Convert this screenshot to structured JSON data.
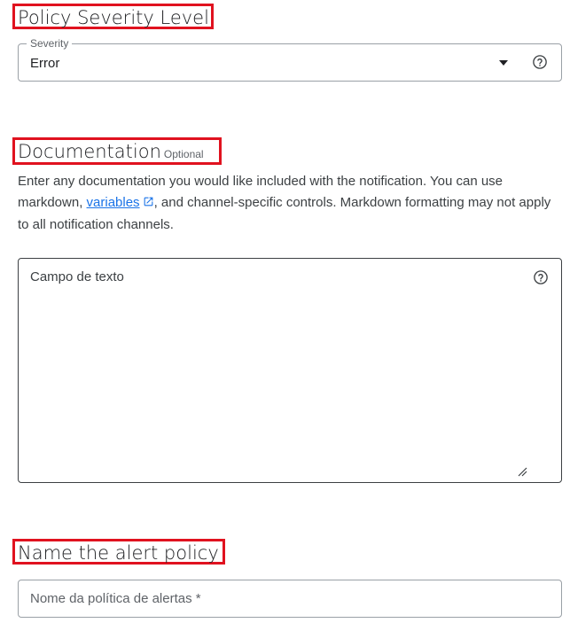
{
  "severity_section": {
    "title": "Policy Severity Level",
    "select": {
      "label": "Severity",
      "value": "Error"
    }
  },
  "documentation_section": {
    "title": "Documentation",
    "optional_tag": "Optional",
    "description_before_link": "Enter any documentation you would like included with the notification. You can use markdown, ",
    "link_text": "variables",
    "description_after_link": ", and channel-specific controls. Markdown formatting may not apply to all notification channels.",
    "textarea": {
      "placeholder": "Campo de texto"
    }
  },
  "name_section": {
    "title": "Name the alert policy",
    "input": {
      "placeholder": "Nome da política de alertas *"
    }
  },
  "colors": {
    "highlight_border": "#e0121f",
    "link": "#1a73e8"
  },
  "icons": [
    "chevron-down-icon",
    "help-icon",
    "external-link-icon",
    "resize-handle-icon"
  ]
}
